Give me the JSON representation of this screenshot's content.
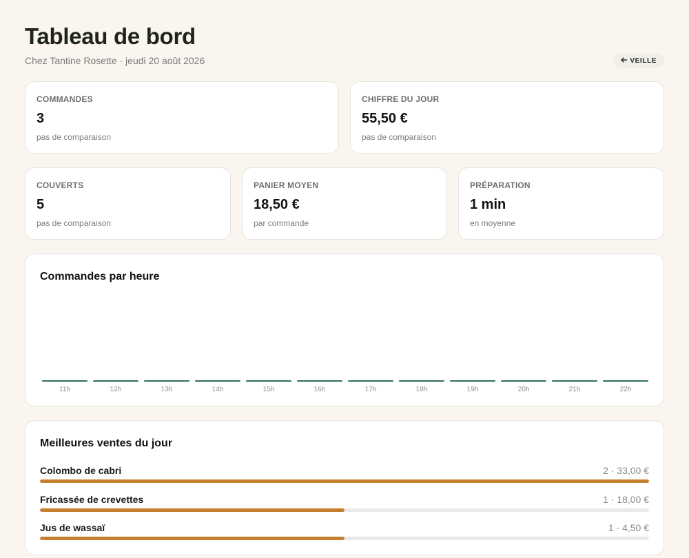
{
  "header": {
    "title": "Tableau de bord",
    "subtitle": "Chez Tantine Rosette · jeudi 20 août 2026",
    "prev_button": {
      "icon": "arrow-left-icon",
      "label": "VEILLE"
    }
  },
  "kpis": [
    {
      "label": "COMMANDES",
      "value": "3",
      "sub": "pas de comparaison"
    },
    {
      "label": "CHIFFRE DU JOUR",
      "value": "55,50 €",
      "sub": "pas de comparaison"
    },
    {
      "label": "COUVERTS",
      "value": "5",
      "sub": "pas de comparaison"
    },
    {
      "label": "PANIER MOYEN",
      "value": "18,50 €",
      "sub": "par commande"
    },
    {
      "label": "PRÉPARATION",
      "value": "1 min",
      "sub": "en moyenne"
    }
  ],
  "hourly": {
    "title": "Commandes par heure"
  },
  "chart_data": {
    "type": "bar",
    "title": "Commandes par heure",
    "categories": [
      "11h",
      "12h",
      "13h",
      "14h",
      "15h",
      "16h",
      "17h",
      "18h",
      "19h",
      "20h",
      "21h",
      "22h"
    ],
    "values": [
      0,
      0,
      0,
      0,
      0,
      0,
      0,
      0,
      0,
      0,
      0,
      0
    ],
    "color": "#2f6e5e"
  },
  "top_sales": {
    "title": "Meilleures ventes du jour",
    "color": "#c57f30",
    "items": [
      {
        "name": "Colombo de cabri",
        "meta": "2 · 33,00 €",
        "share": 1.0
      },
      {
        "name": "Fricassée de crevettes",
        "meta": "1 · 18,00 €",
        "share": 0.5
      },
      {
        "name": "Jus de wassaï",
        "meta": "1 · 4,50 €",
        "share": 0.5
      }
    ]
  }
}
